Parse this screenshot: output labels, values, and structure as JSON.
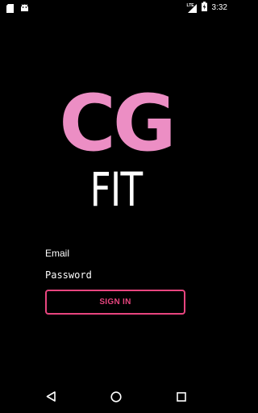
{
  "status_bar": {
    "time": "3:32",
    "network_label": "LTE",
    "icons": [
      "sd-card-icon",
      "android-debug-icon",
      "signal-icon",
      "battery-charging-icon"
    ]
  },
  "logo": {
    "letters": "CG",
    "subtitle": "FIT",
    "accent_color": "#ec8ec4"
  },
  "form": {
    "email_placeholder": "Email",
    "password_placeholder": "Password",
    "sign_in_label": "SIGN IN",
    "button_color": "#e8457f"
  },
  "nav_bar": {
    "icons": [
      "back-icon",
      "home-icon",
      "recent-apps-icon"
    ]
  }
}
